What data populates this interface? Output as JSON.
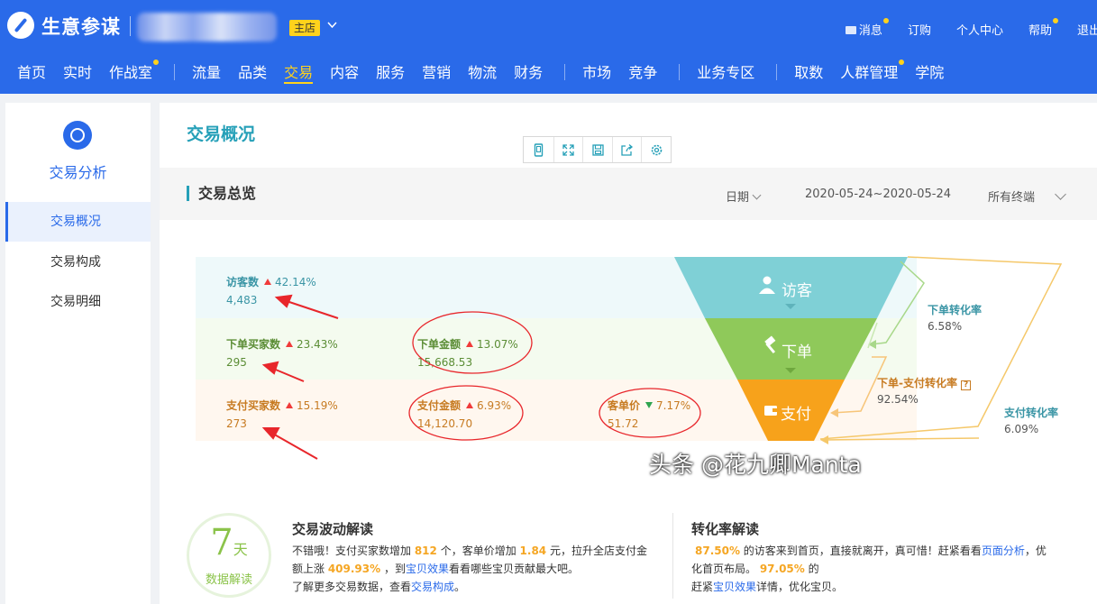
{
  "header": {
    "brand": "生意参谋",
    "shop_badge": "主店",
    "links": [
      {
        "label": "消息",
        "dot": true,
        "icon": true
      },
      {
        "label": "订购",
        "dot": false
      },
      {
        "label": "个人中心",
        "dot": false
      },
      {
        "label": "帮助",
        "dot": true
      },
      {
        "label": "退出",
        "dot": false
      }
    ]
  },
  "nav": {
    "groups": [
      [
        {
          "label": "首页"
        },
        {
          "label": "实时"
        },
        {
          "label": "作战室",
          "dot": true
        }
      ],
      [
        {
          "label": "流量"
        },
        {
          "label": "品类"
        },
        {
          "label": "交易",
          "active": true
        },
        {
          "label": "内容"
        },
        {
          "label": "服务"
        },
        {
          "label": "营销"
        },
        {
          "label": "物流"
        },
        {
          "label": "财务"
        }
      ],
      [
        {
          "label": "市场"
        },
        {
          "label": "竞争"
        }
      ],
      [
        {
          "label": "业务专区"
        }
      ],
      [
        {
          "label": "取数"
        },
        {
          "label": "人群管理",
          "dot": true
        },
        {
          "label": "学院"
        }
      ]
    ]
  },
  "sidebar": {
    "title": "交易分析",
    "items": [
      {
        "label": "交易概况",
        "active": true
      },
      {
        "label": "交易构成"
      },
      {
        "label": "交易明细"
      }
    ]
  },
  "main": {
    "title": "交易概况",
    "toolbar": [
      "phone-icon",
      "fullscreen-icon",
      "save-icon",
      "share-icon",
      "settings-icon"
    ],
    "section_title": "交易总览",
    "date_label": "日期",
    "date_range": "2020-05-24~2020-05-24",
    "terminal": "所有终端"
  },
  "overview": {
    "visitors": {
      "label": "访客数",
      "pct": "42.14%",
      "value": "4,483"
    },
    "order_buyers": {
      "label": "下单买家数",
      "pct": "23.43%",
      "value": "295"
    },
    "order_amount": {
      "label": "下单金额",
      "pct": "13.07%",
      "value": "15,668.53"
    },
    "pay_buyers": {
      "label": "支付买家数",
      "pct": "15.19%",
      "value": "273"
    },
    "pay_amount": {
      "label": "支付金额",
      "pct": "6.93%",
      "value": "14,120.70"
    },
    "avg_price": {
      "label": "客单价",
      "pct": "7.17%",
      "value": "51.72",
      "trend": "down"
    }
  },
  "funnel": {
    "stage1": "访客",
    "stage2": "下单",
    "stage3": "支付",
    "colors": {
      "stage1": "#7fd0d6",
      "stage2": "#8fc95a",
      "stage3": "#f7a21b"
    }
  },
  "conversion": {
    "order_rate": {
      "label": "下单转化率",
      "value": "6.58%"
    },
    "order_pay_rate": {
      "label": "下单-支付转化率",
      "value": "92.54%"
    },
    "pay_rate": {
      "label": "支付转化率",
      "value": "6.09%"
    }
  },
  "interpretation": {
    "seven_num": "7",
    "seven_unit": "天",
    "seven_caption": "数据解读",
    "trade_title": "交易波动解读",
    "trade_p1_a": "不错哦！支付买家数增加 ",
    "trade_p1_n1": "812",
    "trade_p1_b": " 个，客单价增加 ",
    "trade_p1_n2": "1.84",
    "trade_p1_c": " 元，拉升全店支付金",
    "trade_p2_a": "额上涨 ",
    "trade_p2_n": "409.93%",
    "trade_p2_b": " ，到",
    "trade_p2_link": "宝贝效果",
    "trade_p2_c": "看看哪些宝贝贡献最大吧。",
    "trade_p3_a": "了解更多交易数据，查看",
    "trade_p3_link": "交易构成",
    "trade_p3_b": "。",
    "conv_title": "转化率解读",
    "conv_p1_n": "87.50%",
    "conv_p1_a": " 的访客来到首页，直接就离开，真可惜！赶紧看看",
    "conv_p1_link": "页面分析",
    "conv_p1_b": "，优",
    "conv_p2_a": "化首页布局。 ",
    "conv_p2_n": "97.05%",
    "conv_p2_b": " 的",
    "conv_p3_a": "赶紧",
    "conv_p3_link": "宝贝效果",
    "conv_p3_b": "详情，优化宝贝。"
  },
  "watermark": "头条 @花九卿Manta"
}
